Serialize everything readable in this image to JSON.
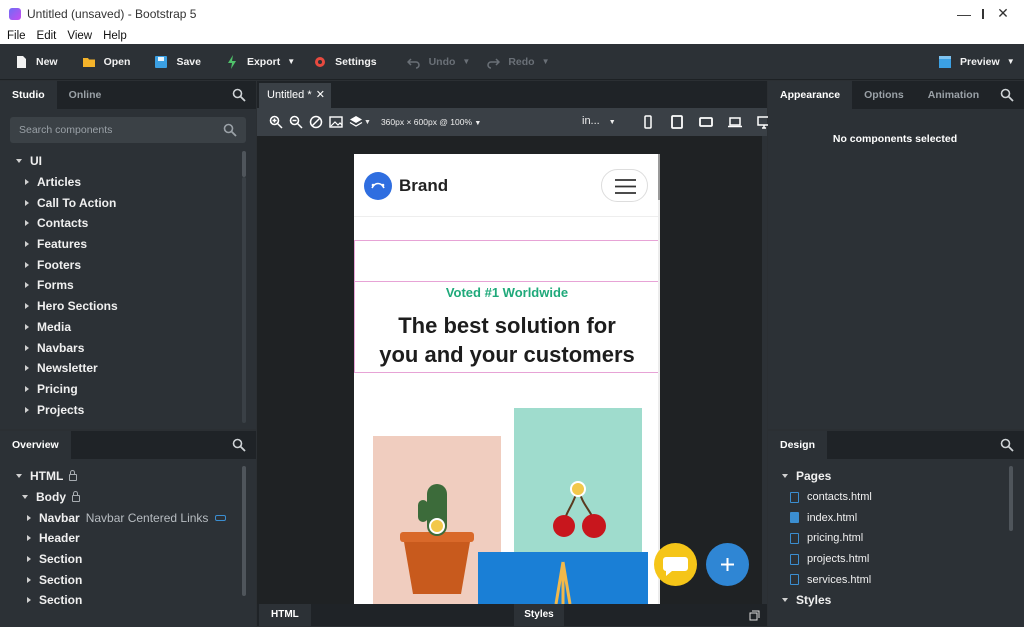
{
  "window": {
    "title": "Untitled (unsaved) - Bootstrap 5"
  },
  "menu": [
    "File",
    "Edit",
    "View",
    "Help"
  ],
  "toolbar": {
    "new": "New",
    "open": "Open",
    "save": "Save",
    "export": "Export",
    "settings": "Settings",
    "undo": "Undo",
    "redo": "Redo",
    "preview": "Preview"
  },
  "left": {
    "tabs": [
      "Studio",
      "Online"
    ],
    "search_placeholder": "Search components",
    "root": "UI",
    "components": [
      "Articles",
      "Call To Action",
      "Contacts",
      "Features",
      "Footers",
      "Forms",
      "Hero Sections",
      "Media",
      "Navbars",
      "Newsletter",
      "Pricing",
      "Projects"
    ]
  },
  "overview": {
    "tab": "Overview",
    "html": "HTML",
    "body": "Body",
    "navbar": "Navbar",
    "navbar_sub": "Navbar Centered Links",
    "items": [
      "Header",
      "Section",
      "Section",
      "Section"
    ]
  },
  "center": {
    "doc_tab": "Untitled *",
    "viewport": "360px × 600px @ 100%",
    "zoom_sel": "in...",
    "bottom_html": "HTML",
    "bottom_styles": "Styles"
  },
  "preview_page": {
    "brand": "Brand",
    "eyebrow": "Voted #1 Worldwide",
    "headline_1": "The best solution for",
    "headline_2": "you and your customers"
  },
  "right": {
    "tabs": [
      "Appearance",
      "Options",
      "Animation"
    ],
    "empty": "No components selected",
    "design_tab": "Design",
    "pages_label": "Pages",
    "pages": [
      "contacts.html",
      "index.html",
      "pricing.html",
      "projects.html",
      "services.html"
    ],
    "styles_label": "Styles"
  },
  "colors": {
    "accent": "#2f86d4",
    "chat": "#f5c518",
    "eyebrow": "#1fa97a"
  }
}
